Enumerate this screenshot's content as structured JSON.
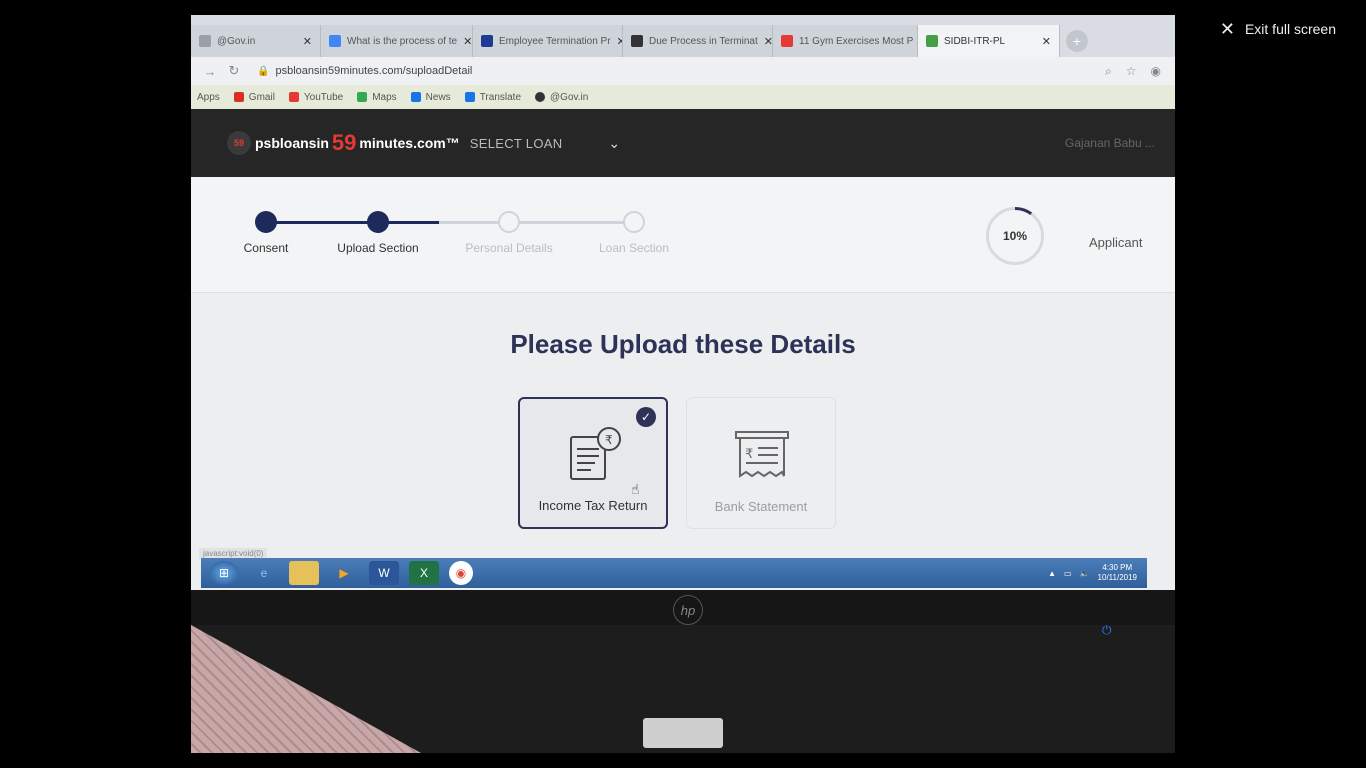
{
  "viewer": {
    "exit_label": "Exit full screen"
  },
  "browser": {
    "tabs": [
      {
        "label": "@Gov.in",
        "color": "#9aa0a6"
      },
      {
        "label": "What is the process of te",
        "color": "#4285f4"
      },
      {
        "label": "Employee Termination Pr",
        "color": "#1f3a93"
      },
      {
        "label": "Due Process in Terminat",
        "color": "#333333"
      },
      {
        "label": "11 Gym Exercises Most P",
        "color": "#e53935"
      },
      {
        "label": "SIDBI-ITR-PL",
        "color": "#43a047"
      }
    ],
    "url": "psbloansin59minutes.com/suploadDetail",
    "bookmarks": [
      {
        "label": "Apps",
        "color": "#9aa0a6"
      },
      {
        "label": "Gmail",
        "color": "#d93025"
      },
      {
        "label": "YouTube",
        "color": "#e53935"
      },
      {
        "label": "Maps",
        "color": "#34a853"
      },
      {
        "label": "News",
        "color": "#1a73e8"
      },
      {
        "label": "Translate",
        "color": "#1a73e8"
      },
      {
        "label": "@Gov.in",
        "color": "#333333"
      }
    ],
    "status_url": "javascript:void(0)"
  },
  "site": {
    "logo_prefix": "psbloansin",
    "logo_number": "59",
    "logo_suffix": "minutes.com™",
    "logo_badge": "59",
    "select_loan": "SELECT LOAN",
    "user_name": "Gajanan Babu ..."
  },
  "progress": {
    "steps": [
      {
        "label": "Consent",
        "state": "done"
      },
      {
        "label": "Upload Section",
        "state": "done"
      },
      {
        "label": "Personal Details",
        "state": "todo"
      },
      {
        "label": "Loan Section",
        "state": "todo"
      }
    ],
    "percent_label": "10%",
    "percent_value": 10,
    "role": "Applicant"
  },
  "upload": {
    "heading": "Please Upload these Details",
    "cards": [
      {
        "label": "Income Tax Return",
        "selected": true
      },
      {
        "label": "Bank Statement",
        "selected": false
      }
    ]
  },
  "taskbar": {
    "time": "4:30 PM",
    "date": "10/11/2019"
  },
  "colors": {
    "primary": "#2d3257",
    "accent_red": "#e53935",
    "header_bg": "#262626"
  }
}
